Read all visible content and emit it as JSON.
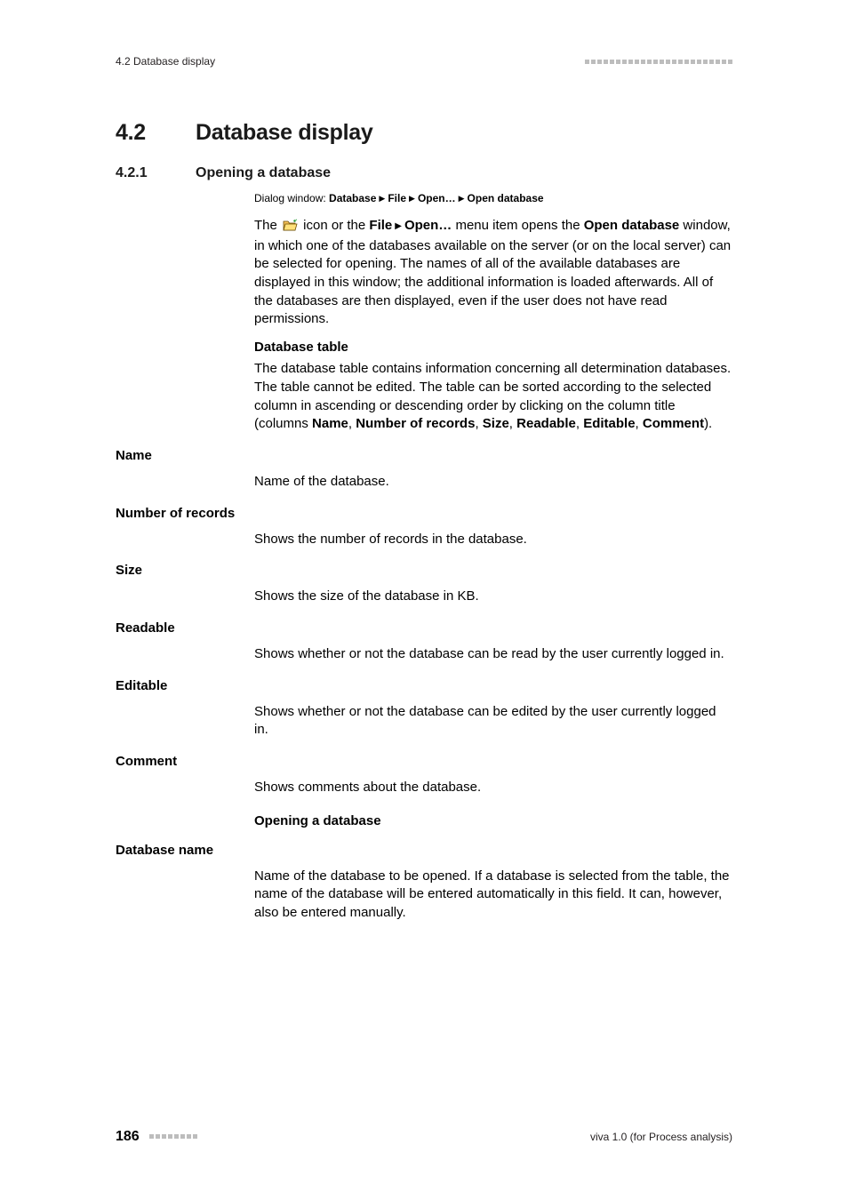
{
  "header": {
    "left": "4.2 Database display"
  },
  "section": {
    "h2_num": "4.2",
    "h2_title": "Database display",
    "h3_num": "4.2.1",
    "h3_title": "Opening a database"
  },
  "dialog_path": {
    "label": "Dialog window: ",
    "p1": "Database",
    "p2": "File",
    "p3": "Open…",
    "p4": "Open database"
  },
  "intro": {
    "t1": "The ",
    "t2": " icon or the ",
    "b1": "File",
    "b2": "Open…",
    "t3": " menu item opens the ",
    "b3": "Open database",
    "t4": " window, in which one of the databases available on the server (or on the local server) can be selected for opening. The names of all of the available databases are displayed in this window; the additional information is loaded afterwards. All of the databases are then displayed, even if the user does not have read permissions."
  },
  "db_table": {
    "head": "Database table",
    "t1": "The database table contains information concerning all determination databases. The table cannot be edited. The table can be sorted according to the selected column in ascending or descending order by clicking on the column title (columns ",
    "c1": "Name",
    "c2": "Number of records",
    "c3": "Size",
    "c4": "Readable",
    "c5": "Editable",
    "c6": "Comment",
    "t2": ")."
  },
  "fields": [
    {
      "label": "Name",
      "desc": "Name of the database."
    },
    {
      "label": "Number of records",
      "desc": "Shows the number of records in the database."
    },
    {
      "label": "Size",
      "desc": "Shows the size of the database in KB."
    },
    {
      "label": "Readable",
      "desc": "Shows whether or not the database can be read by the user currently logged in."
    },
    {
      "label": "Editable",
      "desc": "Shows whether or not the database can be edited by the user currently logged in."
    },
    {
      "label": "Comment",
      "desc": "Shows comments about the database."
    }
  ],
  "opening": {
    "head": "Opening a database"
  },
  "fields2": [
    {
      "label": "Database name",
      "desc": "Name of the database to be opened. If a database is selected from the table, the name of the database will be entered automatically in this field. It can, however, also be entered manually."
    }
  ],
  "footer": {
    "page": "186",
    "right": "viva 1.0 (for Process analysis)"
  },
  "header_dots_count": 24,
  "footer_dots_count": 8
}
